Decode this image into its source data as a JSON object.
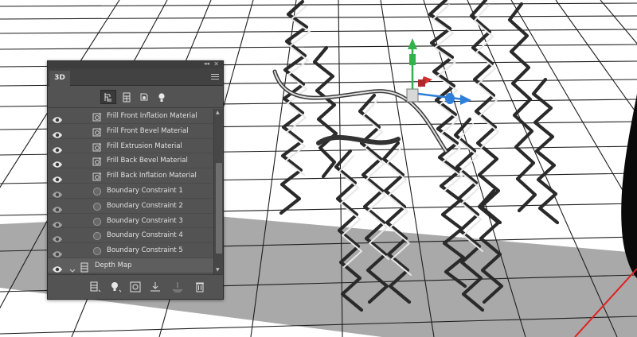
{
  "panel": {
    "tab_label": "3D",
    "collapse_glyph": "◂◂",
    "close_glyph": "✕",
    "filters": [
      {
        "icon": "whole-scene-icon",
        "active": true
      },
      {
        "icon": "meshes-filter-icon",
        "active": false
      },
      {
        "icon": "materials-filter-icon",
        "active": false
      },
      {
        "icon": "lights-filter-icon",
        "active": false
      }
    ],
    "layers": [
      {
        "label": "Frill Front Inflation Material",
        "type": "material",
        "visible": true
      },
      {
        "label": "Frill Front Bevel Material",
        "type": "material",
        "visible": true
      },
      {
        "label": "Frill Extrusion Material",
        "type": "material",
        "visible": true
      },
      {
        "label": "Frill Back Bevel Material",
        "type": "material",
        "visible": true
      },
      {
        "label": "Frill Back Inflation Material",
        "type": "material",
        "visible": true
      },
      {
        "label": "Boundary Constraint 1",
        "type": "constraint",
        "visible": false
      },
      {
        "label": "Boundary Constraint 2",
        "type": "constraint",
        "visible": false
      },
      {
        "label": "Boundary Constraint 3",
        "type": "constraint",
        "visible": false
      },
      {
        "label": "Boundary Constraint 4",
        "type": "constraint",
        "visible": false
      },
      {
        "label": "Boundary Constraint 5",
        "type": "constraint",
        "visible": false
      }
    ],
    "depth_map_label": "Depth Map",
    "bottom_actions": [
      "new-mesh-icon",
      "new-light-icon",
      "render-icon",
      "drop-to-ground-icon",
      "align-icon",
      "delete-icon"
    ]
  },
  "colors": {
    "panel_bg": "#535353",
    "gizmo_y": "#2fb34a",
    "gizmo_x": "#d03030",
    "gizmo_z": "#2f7fd8",
    "ground_shadow": "#a9a9a9",
    "red_line": "#e02020"
  }
}
